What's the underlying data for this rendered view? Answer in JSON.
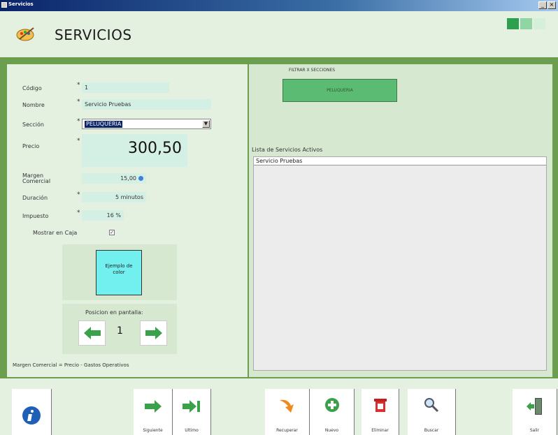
{
  "window": {
    "title": "Servicios",
    "min_label": "_",
    "close_label": "×"
  },
  "header": {
    "title": "SERVICIOS",
    "colors": [
      "#2e9e4f",
      "#8fd6a4",
      "#d6efd9"
    ]
  },
  "form": {
    "codigo": {
      "label": "Código",
      "value": "1",
      "required": "*"
    },
    "nombre": {
      "label": "Nombre",
      "value": "Servicio Pruebas",
      "required": "*"
    },
    "seccion": {
      "label": "Sección",
      "value": "PELUQUERIA",
      "required": "*"
    },
    "precio": {
      "label": "Precio",
      "value": "300,50",
      "required": "*"
    },
    "margen": {
      "label_line1": "Margen",
      "label_line2": "Comercial",
      "value": "15,00"
    },
    "duracion": {
      "label": "Duración",
      "value": "5 minutos",
      "required": "*"
    },
    "impuesto": {
      "label": "Impuesto",
      "value": "16 %",
      "required": "*"
    },
    "mostrar_caja": {
      "label": "Mostrar en Caja",
      "checked": "✓"
    },
    "color_example": {
      "line1": "Ejemplo de",
      "line2": "color",
      "color": "#72f0f0"
    },
    "posicion": {
      "label": "Posicion en pantalla:",
      "value": "1"
    },
    "formula": "Margen Comercial = Precio - Gastos Operativos"
  },
  "filter": {
    "label": "FILTRAR X SECCIONES",
    "button": "PELUQUERIA"
  },
  "list": {
    "label": "Lista de Servicios Activos",
    "items": [
      "Servicio Pruebas"
    ]
  },
  "toolbar": {
    "info": "",
    "siguiente": "Siguiente",
    "ultimo": "Ultimo",
    "recuperar": "Recuperar",
    "nuevo": "Nuevo",
    "eliminar": "Eliminar",
    "buscar": "Buscar",
    "salir": "Salir"
  },
  "colors": {
    "panel_bg": "#e4f1e1",
    "frame_green": "#6c9e4f",
    "field_bg": "#d4f0e4",
    "accent_green": "#5bbb73"
  }
}
